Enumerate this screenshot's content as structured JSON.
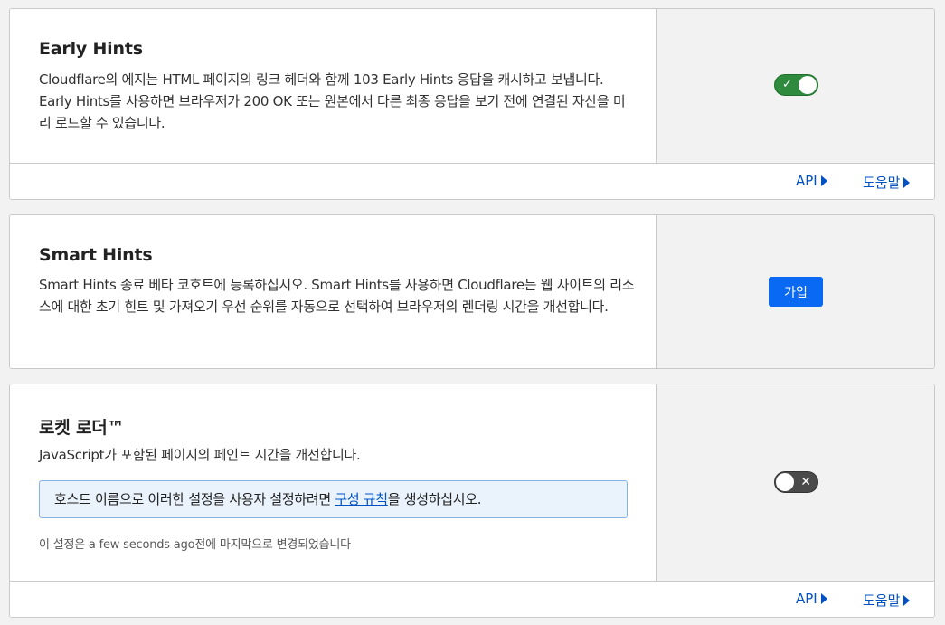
{
  "early_hints": {
    "title": "Early Hints",
    "description": "Cloudflare의 에지는 HTML 페이지의 링크 헤더와 함께 103 Early Hints 응답을 캐시하고 보냅니다. Early Hints를 사용하면 브라우저가 200 OK 또는 원본에서 다른 최종 응답을 보기 전에 연결된 자산을 미리 로드할 수 있습니다.",
    "toggle_state": "on",
    "toggle_mark": "✓",
    "api_label": "API",
    "help_label": "도움말"
  },
  "smart_hints": {
    "title": "Smart Hints",
    "description": "Smart Hints 종료 베타 코호트에 등록하십시오. Smart Hints를 사용하면 Cloudflare는 웹 사이트의 리소스에 대한 초기 힌트 및 가져오기 우선 순위를 자동으로 선택하여 브라우저의 렌더링 시간을 개선합니다.",
    "join_label": "가입"
  },
  "rocket_loader": {
    "title": "로켓 로더™",
    "description": "JavaScript가 포함된 페이지의 페인트 시간을 개선합니다.",
    "info_prefix": "호스트 이름으로 이러한 설정을 사용자 설정하려면 ",
    "info_link": "구성 규칙",
    "info_suffix": "을 생성하십시오.",
    "last_modified": "이 설정은 a few seconds ago전에 마지막으로 변경되었습니다",
    "toggle_state": "off",
    "toggle_mark": "✕",
    "api_label": "API",
    "help_label": "도움말"
  },
  "colors": {
    "link": "#0051c3",
    "toggle_on": "#2e8b3e",
    "toggle_off": "#4a4a4a",
    "primary_button": "#0969f2",
    "info_bg": "#eaf2fc"
  }
}
